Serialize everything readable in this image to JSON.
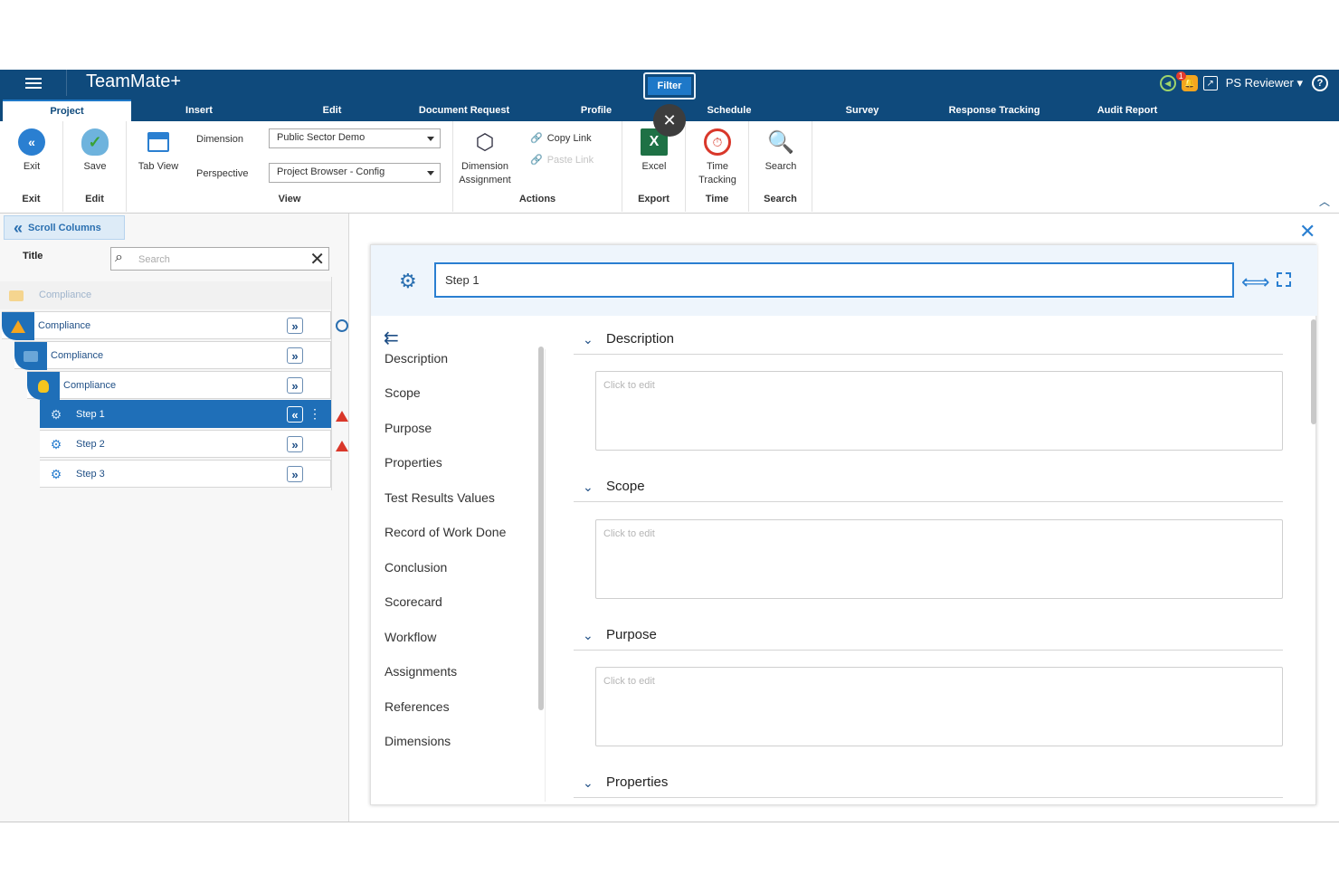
{
  "app": {
    "title": "TeamMate+",
    "filter_label": "Filter",
    "user": "PS Reviewer",
    "notification_count": "1"
  },
  "tabs": [
    {
      "label": "Project"
    },
    {
      "label": "Insert"
    },
    {
      "label": "Edit"
    },
    {
      "label": "Document Request"
    },
    {
      "label": "Profile"
    },
    {
      "label": "Schedule"
    },
    {
      "label": "Survey"
    },
    {
      "label": "Response Tracking"
    },
    {
      "label": "Audit Report"
    }
  ],
  "ribbon": {
    "exit": {
      "button": "Exit",
      "group": "Exit"
    },
    "edit": {
      "save": "Save",
      "group": "Edit"
    },
    "view": {
      "tab_view": "Tab View",
      "dimension_label": "Dimension",
      "dimension_value": "Public Sector Demo",
      "perspective_label": "Perspective",
      "perspective_value": "Project Browser - Config",
      "group": "View"
    },
    "actions": {
      "dimension_assignment_line1": "Dimension",
      "dimension_assignment_line2": "Assignment",
      "copy_link": "Copy Link",
      "paste_link": "Paste Link",
      "group": "Actions"
    },
    "export": {
      "excel": "Excel",
      "group": "Export"
    },
    "time": {
      "line1": "Time",
      "line2": "Tracking",
      "group": "Time"
    },
    "search": {
      "button": "Search",
      "group": "Search"
    }
  },
  "left_panel": {
    "scroll_columns": "Scroll Columns",
    "title_label": "Title",
    "search_placeholder": "Search",
    "tree": [
      {
        "label": "Compliance",
        "icon": "folder-icon"
      },
      {
        "label": "Compliance",
        "icon": "triangle-icon"
      },
      {
        "label": "Compliance",
        "icon": "folder-icon"
      },
      {
        "label": "Compliance",
        "icon": "bulb-icon"
      },
      {
        "label": "Step 1",
        "icon": "gear-icon",
        "selected": true
      },
      {
        "label": "Step 2",
        "icon": "gear-icon"
      },
      {
        "label": "Step 3",
        "icon": "gear-icon"
      }
    ]
  },
  "detail": {
    "title_value": "Step 1",
    "nav": [
      "Description",
      "Scope",
      "Purpose",
      "Properties",
      "Test Results Values",
      "Record of Work Done",
      "Conclusion",
      "Scorecard",
      "Workflow",
      "Assignments",
      "References",
      "Dimensions"
    ],
    "sections": [
      {
        "title": "Description",
        "placeholder": "Click to edit"
      },
      {
        "title": "Scope",
        "placeholder": "Click to edit"
      },
      {
        "title": "Purpose",
        "placeholder": "Click to edit"
      },
      {
        "title": "Properties"
      }
    ]
  }
}
